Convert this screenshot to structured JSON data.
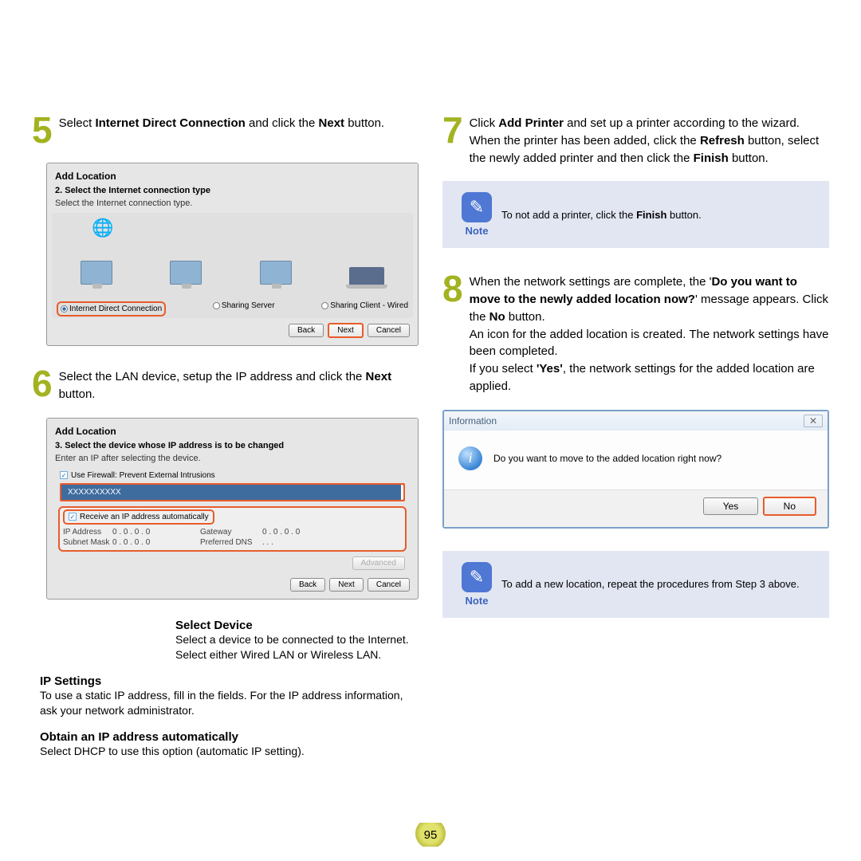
{
  "left": {
    "step5": {
      "num": "5",
      "text_prefix": "Select ",
      "bold1": "Internet Direct Connection",
      "mid": " and click the ",
      "bold2": "Next",
      "suffix": " button."
    },
    "dialog1": {
      "title": "Add Location",
      "subtitle": "2. Select the Internet connection type",
      "hint": "Select the Internet connection type.",
      "opt1": "Internet Direct Connection",
      "opt2": "Sharing Server",
      "opt3": "Sharing Client - Wired",
      "back": "Back",
      "next": "Next",
      "cancel": "Cancel"
    },
    "step6": {
      "num": "6",
      "text_prefix": "Select the LAN device, setup the IP address and click the ",
      "bold1": "Next",
      "suffix": " button."
    },
    "dialog2": {
      "title": "Add Location",
      "subtitle": "3. Select the device whose IP address is to be changed",
      "hint": "Enter an IP after selecting the device.",
      "firewall": "Use Firewall: Prevent External Intrusions",
      "device": "XXXXXXXXXX",
      "auto_ip": "Receive an IP address automatically",
      "ip_label": "IP Address",
      "ip_val": "0 . 0 . 0 . 0",
      "gw_label": "Gateway",
      "gw_val": "0 . 0 . 0 . 0",
      "mask_label": "Subnet Mask",
      "mask_val": "0 . 0 . 0 . 0",
      "dns_label": "Preferred DNS",
      "dns_val": ". . .",
      "advanced": "Advanced",
      "back": "Back",
      "next": "Next",
      "cancel": "Cancel"
    },
    "callouts": {
      "sel_device_title": "Select Device",
      "sel_device_text": "Select a device to be connected to the Internet. Select either Wired LAN or Wireless LAN.",
      "ip_title": "IP Settings",
      "ip_text": "To use a static IP address, fill in the fields. For the IP address information, ask your network administrator.",
      "auto_title": "Obtain an IP address automatically",
      "auto_text": "Select DHCP to use this option (automatic IP setting)."
    }
  },
  "right": {
    "step7": {
      "num": "7",
      "p1": "Click ",
      "b1": "Add Printer",
      "p2": " and set up a printer according to the wizard. When the printer has been added, click the ",
      "b2": "Refresh",
      "p3": " button, select the newly added printer and then click the ",
      "b3": "Finish",
      "p4": " button."
    },
    "note1_label": "Note",
    "note1_text_pre": "To not add a printer, click the ",
    "note1_bold": "Finish",
    "note1_text_post": " button.",
    "step8": {
      "num": "8",
      "l1": "When the network settings are complete, the '",
      "b1": "Do you want to move to the newly added location now?",
      "l2": "' message appears. Click the ",
      "b2": "No",
      "l3": " button.",
      "l4": "An icon for the added location is created. The network settings have been completed.",
      "l5a": "If you select ",
      "b3": "'Yes'",
      "l5b": ", the network settings for the added location are applied."
    },
    "info": {
      "title": "Information",
      "msg": "Do you want to move to the added location right now?",
      "yes": "Yes",
      "no": "No",
      "close": "✕"
    },
    "note2_label": "Note",
    "note2_text": "To add a new location, repeat the procedures from Step 3 above."
  },
  "page_number": "95"
}
